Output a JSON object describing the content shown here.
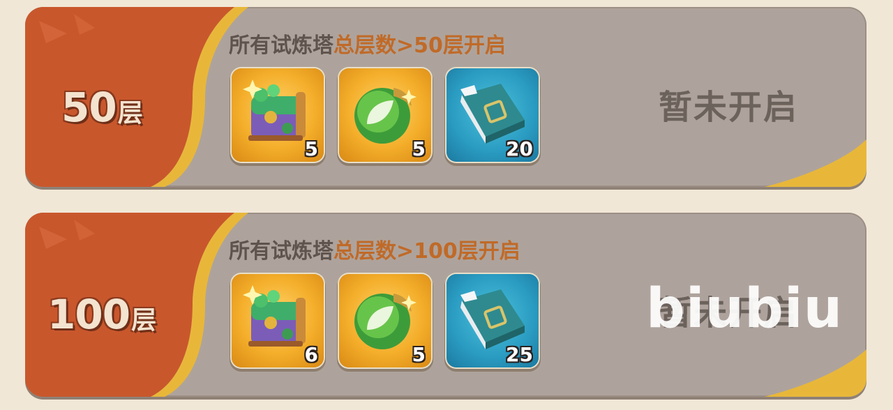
{
  "tiers": [
    {
      "tier_number": "50",
      "tier_unit": "层",
      "condition_main": "所有试炼塔",
      "condition_highlight": "总层数>50层开启",
      "status": "暂未开启",
      "rewards": [
        {
          "icon": "treasure-chest-icon",
          "count": "5"
        },
        {
          "icon": "green-orb-icon",
          "count": "5"
        },
        {
          "icon": "book-icon",
          "count": "20"
        }
      ]
    },
    {
      "tier_number": "100",
      "tier_unit": "层",
      "condition_main": "所有试炼塔",
      "condition_highlight": "总层数>100层开启",
      "status": "暂未开启",
      "rewards": [
        {
          "icon": "treasure-chest-icon",
          "count": "6"
        },
        {
          "icon": "green-orb-icon",
          "count": "5"
        },
        {
          "icon": "book-icon",
          "count": "25"
        }
      ]
    }
  ],
  "watermark": "biubiu",
  "colors": {
    "tab_orange": "#c9572c",
    "tab_gold": "#e8b73a",
    "card_grey": "#aea39c",
    "highlight": "#c06a28",
    "background": "#f1e7d6"
  }
}
